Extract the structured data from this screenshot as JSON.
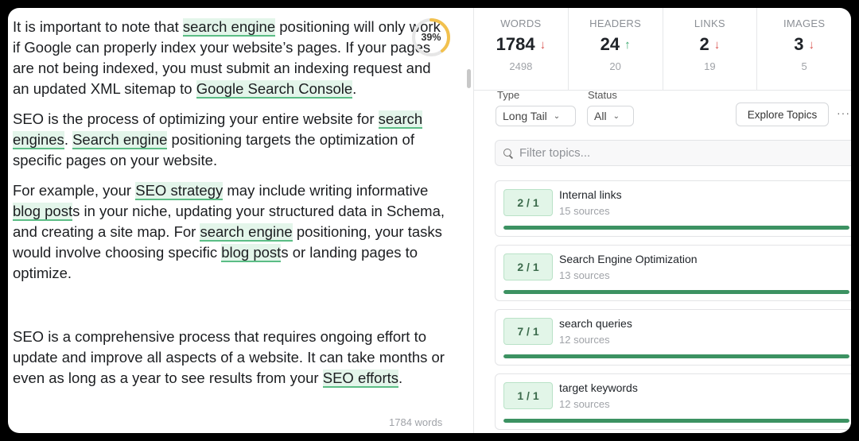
{
  "editor": {
    "p1": [
      {
        "t": "It is important to note that "
      },
      {
        "t": "search engine",
        "kw": true
      },
      {
        "t": " positioning will only work if Google can properly index your website’s pages. If your pages are not being indexed, you must submit an indexing request and an updated XML sitemap to "
      },
      {
        "t": "Google Search Console",
        "kw": true
      },
      {
        "t": "."
      }
    ],
    "p2": [
      {
        "t": "SEO is the process of optimizing your entire website for "
      },
      {
        "t": "search engines",
        "kw": true
      },
      {
        "t": ". "
      },
      {
        "t": "Search engine",
        "kw": true
      },
      {
        "t": " positioning targets the optimization of specific pages on your website."
      }
    ],
    "p3": [
      {
        "t": "For example, your "
      },
      {
        "t": "SEO strategy",
        "kw": true
      },
      {
        "t": " may include writing informative "
      },
      {
        "t": "blog post",
        "kw": true
      },
      {
        "t": "s in your niche, updating your structured data in Schema, and creating a site map. For "
      },
      {
        "t": "search engine",
        "kw": true
      },
      {
        "t": " positioning, your tasks would involve choosing specific "
      },
      {
        "t": "blog post",
        "kw": true
      },
      {
        "t": "s or landing pages to optimize."
      }
    ],
    "p4": [
      {
        "t": "SEO is a comprehensive process that requires ongoing effort to update and improve all aspects of a website. It can take months or even as long as a year to see results from your "
      },
      {
        "t": "SEO efforts",
        "kw": true
      },
      {
        "t": "."
      }
    ],
    "score": "39%",
    "score_value": 0.39,
    "word_count": "1784 words"
  },
  "stats": [
    {
      "label": "WORDS",
      "value": "1784",
      "trend": "down",
      "target": "2498"
    },
    {
      "label": "HEADERS",
      "value": "24",
      "trend": "up",
      "target": "20"
    },
    {
      "label": "LINKS",
      "value": "2",
      "trend": "down",
      "target": "19"
    },
    {
      "label": "IMAGES",
      "value": "3",
      "trend": "down",
      "target": "5"
    }
  ],
  "filters": {
    "type_label": "Type",
    "type_value": "Long Tail",
    "status_label": "Status",
    "status_value": "All",
    "explore_label": "Explore Topics",
    "more_label": "···",
    "search_placeholder": "Filter topics..."
  },
  "topics": [
    {
      "badge": "2 / 1",
      "name": "Internal links",
      "sources": "15 sources",
      "progress": 1.0
    },
    {
      "badge": "2 / 1",
      "name": "Search Engine Optimization",
      "sources": "13 sources",
      "progress": 1.0
    },
    {
      "badge": "7 / 1",
      "name": "search queries",
      "sources": "12 sources",
      "progress": 1.0
    },
    {
      "badge": "1 / 1",
      "name": "target keywords",
      "sources": "12 sources",
      "progress": 1.0
    }
  ],
  "colors": {
    "keyword_bg": "#e3f5ea",
    "keyword_underline": "#5bbd85",
    "score_ring": "#f2c14e",
    "trend_down": "#d9534f",
    "trend_up": "#3aa76d",
    "progress": "#3c9262"
  }
}
